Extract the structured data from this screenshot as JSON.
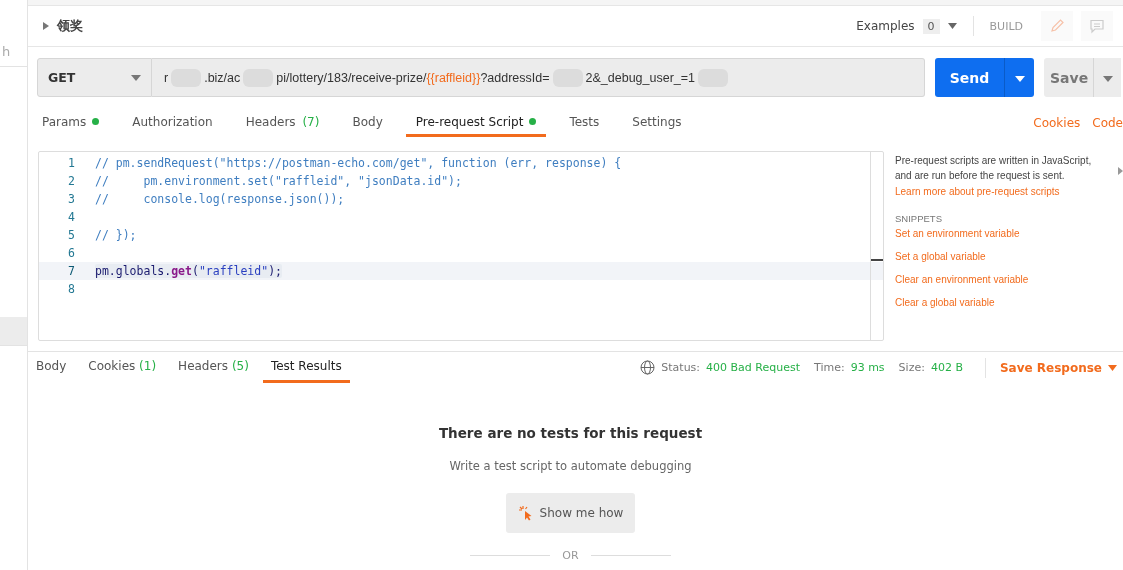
{
  "sidebar": {
    "items": [
      {
        "label": "h",
        "selected": false
      },
      {
        "selected": true
      }
    ]
  },
  "request": {
    "name": "领奖",
    "examples_label": "Examples",
    "examples_count": "0",
    "mode": "BUILD"
  },
  "url_bar": {
    "method": "GET",
    "segments": [
      {
        "kind": "text",
        "text": "r"
      },
      {
        "kind": "redacted"
      },
      {
        "kind": "text",
        "text": ".biz/ac"
      },
      {
        "kind": "redacted"
      },
      {
        "kind": "text",
        "text": "pi/lottery/183/receive-prize/"
      },
      {
        "kind": "variable",
        "text": "{{raffleid}}"
      },
      {
        "kind": "text",
        "text": "?addressId="
      },
      {
        "kind": "redacted"
      },
      {
        "kind": "text",
        "text": "2&_debug_user_=1"
      },
      {
        "kind": "redacted"
      }
    ],
    "send": "Send",
    "save": "Save"
  },
  "request_tabs": [
    {
      "label": "Params",
      "dot": true,
      "selected": false
    },
    {
      "label": "Authorization",
      "dot": false,
      "selected": false
    },
    {
      "label": "Headers",
      "count": "(7)",
      "dot": false,
      "selected": false
    },
    {
      "label": "Body",
      "dot": false,
      "selected": false
    },
    {
      "label": "Pre-request Script",
      "dot": true,
      "selected": true
    },
    {
      "label": "Tests",
      "dot": false,
      "selected": false
    },
    {
      "label": "Settings",
      "dot": false,
      "selected": false
    }
  ],
  "request_links": [
    "Cookies",
    "Code"
  ],
  "editor": {
    "lines": [
      {
        "number": "1",
        "selected": false,
        "tokens": [
          {
            "kind": "comment",
            "text": "// pm.sendRequest(\"https://postman-echo.com/get\", function (err, response) {"
          }
        ]
      },
      {
        "number": "2",
        "selected": false,
        "tokens": [
          {
            "kind": "comment",
            "text": "//     pm.environment.set(\"raffleid\", \"jsonData.id\");"
          }
        ]
      },
      {
        "number": "3",
        "selected": false,
        "tokens": [
          {
            "kind": "comment",
            "text": "//     console.log(response.json());"
          }
        ]
      },
      {
        "number": "4",
        "selected": false
      },
      {
        "number": "5",
        "selected": false,
        "tokens": [
          {
            "kind": "comment",
            "text": "// });"
          }
        ]
      },
      {
        "number": "6",
        "selected": false
      },
      {
        "number": "7",
        "selected": true,
        "tokens": [
          {
            "kind": "plain",
            "text": "pm.globals."
          },
          {
            "kind": "keyword",
            "text": "get"
          },
          {
            "kind": "plain",
            "text": "("
          },
          {
            "kind": "string",
            "text": "\"raffleid\""
          },
          {
            "kind": "plain",
            "text": ");"
          }
        ]
      },
      {
        "number": "8",
        "selected": false
      }
    ]
  },
  "help": {
    "description": "Pre-request scripts are written in JavaScript, and are run before the request is sent.",
    "learn_more": "Learn more about pre-request scripts",
    "snippets_title": "SNIPPETS",
    "snippets": [
      "Set an environment variable",
      "Set a global variable",
      "Clear an environment variable",
      "Clear a global variable"
    ]
  },
  "response_tabs": [
    {
      "label": "Body",
      "selected": false
    },
    {
      "label": "Cookies",
      "count": "(1)",
      "selected": false
    },
    {
      "label": "Headers",
      "count": "(5)",
      "selected": false
    },
    {
      "label": "Test Results",
      "selected": true
    }
  ],
  "status": {
    "status_label": "Status:",
    "status": "400 Bad Request",
    "time_label": "Time:",
    "time": "93 ms",
    "size_label": "Size:",
    "size": "402 B",
    "save_response": "Save Response"
  },
  "empty_state": {
    "title": "There are no tests for this request",
    "subtitle": "Write a test script to automate debugging",
    "button": "Show me how",
    "separator": "OR"
  }
}
